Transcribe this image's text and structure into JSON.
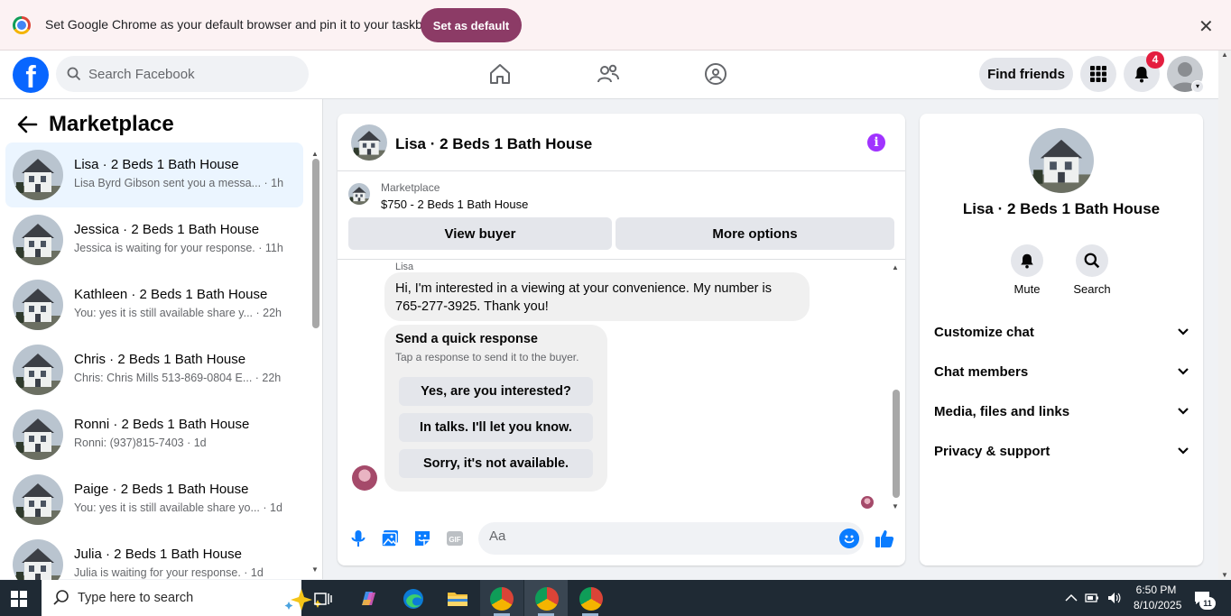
{
  "infobar": {
    "message": "Set Google Chrome as your default browser and pin it to your taskbar",
    "set_default_label": "Set as default",
    "close_label": "✕"
  },
  "header": {
    "logo_letter": "f",
    "search_placeholder": "Search Facebook",
    "find_friends_label": "Find friends",
    "notification_count": "4"
  },
  "marketplace": {
    "title": "Marketplace",
    "conversations": [
      {
        "name": "Lisa · 2 Beds 1 Bath House",
        "preview": "Lisa Byrd Gibson sent you a messa... · 1h",
        "active": true
      },
      {
        "name": "Jessica · 2 Beds 1 Bath House",
        "preview": "Jessica is waiting for your response. · 11h"
      },
      {
        "name": "Kathleen · 2 Beds 1 Bath House",
        "preview": "You: yes it is still available share y... · 22h"
      },
      {
        "name": "Chris · 2 Beds 1 Bath House",
        "preview": "Chris: Chris Mills 513-869-0804 E... · 22h"
      },
      {
        "name": "Ronni · 2 Beds 1 Bath House",
        "preview": "Ronni: (937)815-7403 · 1d"
      },
      {
        "name": "Paige · 2 Beds 1 Bath House",
        "preview": "You: yes it is still available share yo... · 1d"
      },
      {
        "name": "Julia · 2 Beds 1 Bath House",
        "preview": "Julia is waiting for your response. · 1d"
      }
    ]
  },
  "chat": {
    "title": "Lisa · 2 Beds 1 Bath House",
    "info_icon": "i",
    "listing_label": "Marketplace",
    "listing_price": "$750 - 2 Beds 1 Bath House",
    "view_buyer_label": "View buyer",
    "more_options_label": "More options",
    "sender_label": "Lisa",
    "message": "Hi, I'm interested in a viewing at your convenience. My number is 765-277-3925. Thank you!",
    "quick_title": "Send a quick response",
    "quick_subtitle": "Tap a response to send it to the buyer.",
    "quick_responses": [
      "Yes, are you interested?",
      "In talks. I'll let you know.",
      "Sorry, it's not available."
    ],
    "input_placeholder": "Aa"
  },
  "details": {
    "name": "Lisa · 2 Beds 1 Bath House",
    "mute_label": "Mute",
    "search_label": "Search",
    "sections": [
      "Customize chat",
      "Chat members",
      "Media, files and links",
      "Privacy & support"
    ]
  },
  "taskbar": {
    "search_placeholder": "Type here to search",
    "time": "6:50 PM",
    "date": "8/10/2025",
    "notif_count": "11"
  },
  "colors": {
    "fb_blue": "#0866ff",
    "messenger_blue": "#0a7cff",
    "badge_red": "#e41e3f",
    "set_default_purple": "#8c3b66",
    "info_purple": "#a033ff"
  }
}
